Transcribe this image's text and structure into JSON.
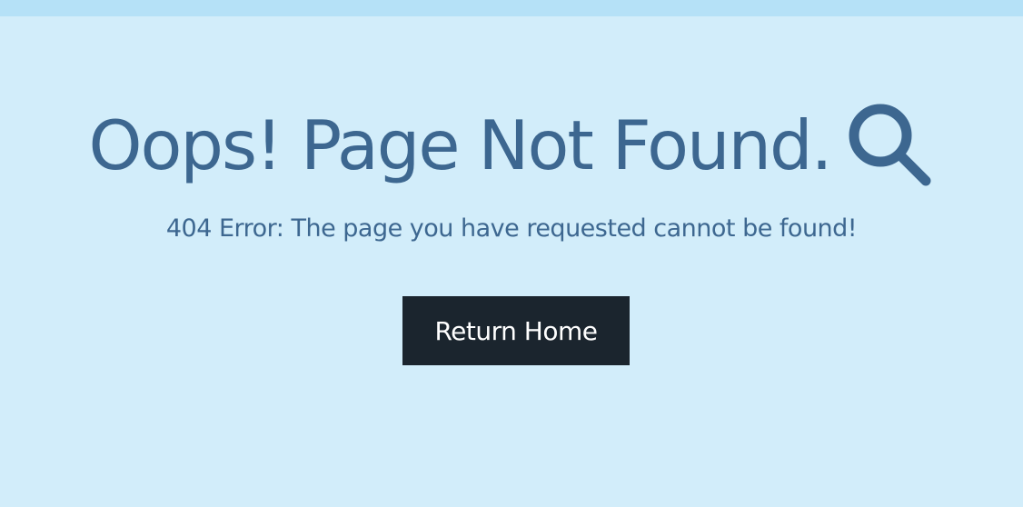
{
  "page": {
    "headline": "Oops! Page Not Found.",
    "headline_icon": "search-icon",
    "subtitle": "404 Error: The page you have requested cannot be found!",
    "return_button_label": "Return Home"
  },
  "colors": {
    "background": "#d2edfa",
    "top_bar": "#b5e1f7",
    "text": "#3d6790",
    "button_background": "#1b252e",
    "button_text": "#ffffff"
  }
}
